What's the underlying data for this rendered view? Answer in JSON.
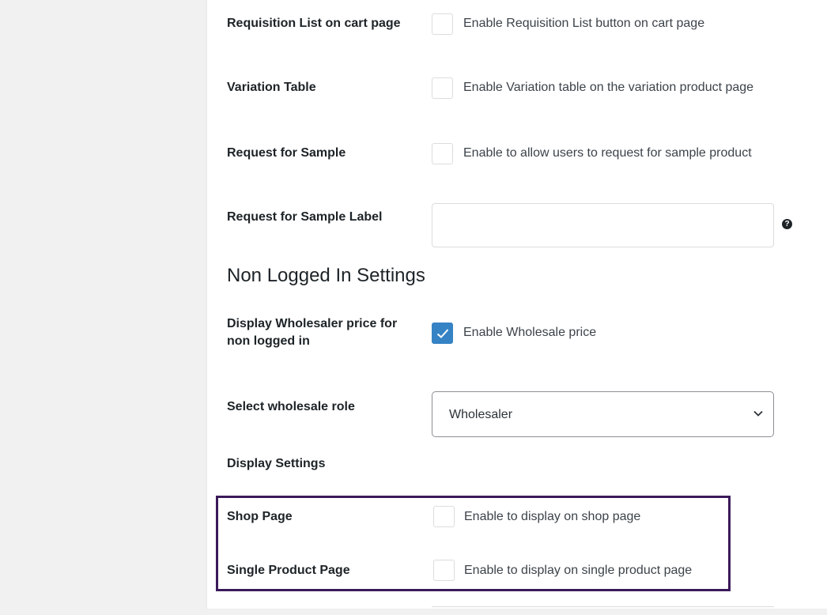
{
  "settings": {
    "requisition": {
      "label": "Requisition List on cart page",
      "description": "Enable Requisition List button on cart page",
      "checked": false
    },
    "variation": {
      "label": "Variation Table",
      "description": "Enable Variation table on the variation product page",
      "checked": false
    },
    "sample": {
      "label": "Request for Sample",
      "description": "Enable to allow users to request for sample product",
      "checked": false
    },
    "sample_label": {
      "label": "Request for Sample Label",
      "value": "",
      "help_icon": "question-circle-icon",
      "help_glyph": "?"
    }
  },
  "non_logged": {
    "heading": "Non Logged In Settings",
    "wholesale_price": {
      "label": "Display Wholesaler price for non logged in",
      "description": "Enable Wholesale price",
      "checked": true
    },
    "role": {
      "label": "Select wholesale role",
      "selected": "Wholesaler"
    }
  },
  "display": {
    "heading": "Display Settings",
    "shop_page": {
      "label": "Shop Page",
      "description": "Enable to display on shop page",
      "checked": false
    },
    "single_product": {
      "label": "Single Product Page",
      "description": "Enable to display on single product page",
      "checked": false
    }
  },
  "colors": {
    "accent": "#3582c4",
    "highlight_border": "#3b1a5a",
    "panel_bg": "#ffffff",
    "page_bg": "#f1f1f1"
  }
}
